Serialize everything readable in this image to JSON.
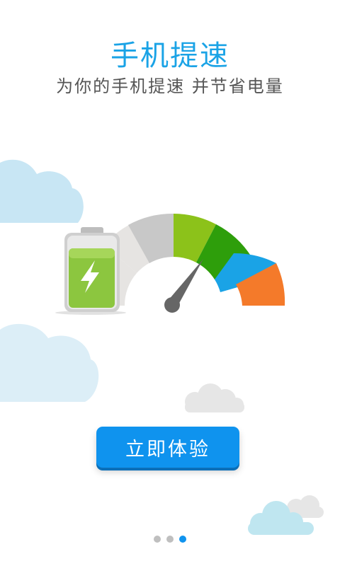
{
  "header": {
    "title": "手机提速",
    "subtitle": "为你的手机提速 并节省电量"
  },
  "cta": {
    "label": "立即体验"
  },
  "pager": {
    "pages": 3,
    "active_index": 2
  },
  "colors": {
    "accent": "#0f93ee",
    "title": "#1aa3e6",
    "battery_green": "#8cc63f",
    "gauge_segments": [
      "#e6e4e2",
      "#c8c8c8",
      "#8cc21a",
      "#2e9e0b",
      "#1aa3e6",
      "#f47a2a"
    ]
  }
}
